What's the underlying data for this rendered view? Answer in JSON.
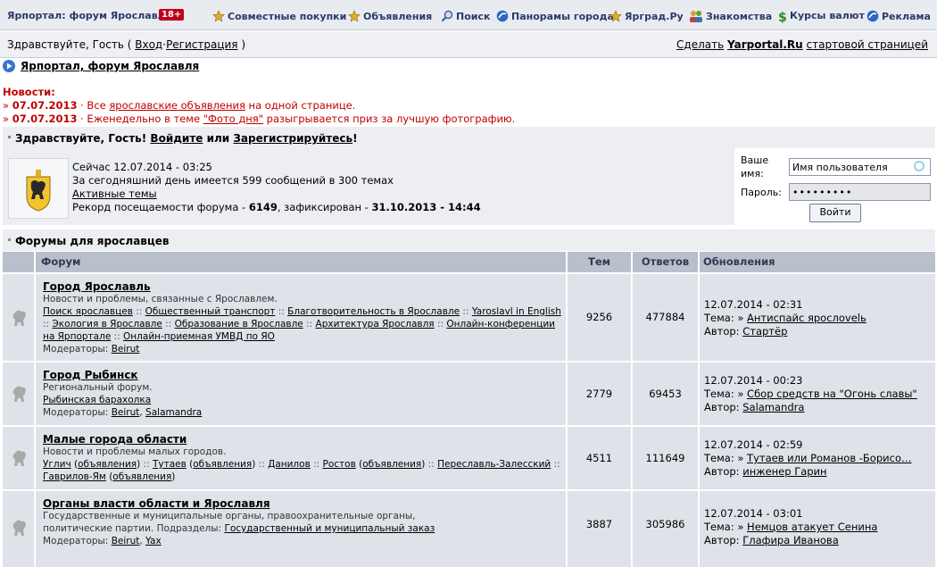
{
  "topbar": {
    "site_title": "Ярпортал: форум Ярославля",
    "age_badge": "18+",
    "nav": [
      {
        "label": "Совместные покупки",
        "icon": "star-icon"
      },
      {
        "label": "Объявления",
        "icon": "star-icon"
      },
      {
        "label": "Поиск",
        "icon": "search-icon"
      },
      {
        "label": "Панорамы города",
        "icon": "panorama-icon"
      },
      {
        "label": "Ярград.Ру",
        "icon": "star-icon"
      },
      {
        "label": "Знакомства",
        "icon": "people-icon"
      },
      {
        "label": "Курсы валют",
        "icon": "dollar-icon"
      },
      {
        "label": "Реклама",
        "icon": "panorama-icon"
      }
    ]
  },
  "greeting": {
    "prefix": "Здравствуйте, Гость (",
    "login": "Вход",
    "dot": "·",
    "register": "Регистрация",
    "suffix": ")",
    "make_start_pre": "Сделать",
    "make_start_bold": "Yarportal.Ru",
    "make_start_post": "стартовой страницей"
  },
  "breadcrumb": "Ярпортал, форум Ярославля",
  "news": {
    "title": "Новости:",
    "items": [
      {
        "date": "07.07.2013",
        "pre": " · Все ",
        "link": "ярославские объявления",
        "post": " на одной странице."
      },
      {
        "date": "07.07.2013",
        "pre": " · Еженедельно в теме ",
        "link": "\"Фото дня\"",
        "post": " разыгрывается приз за лучшую фотографию."
      }
    ]
  },
  "welcome": {
    "pre": "Здравствуйте, Гость! ",
    "login": "Войдите",
    "mid": " или ",
    "register": "Зарегистрируйтесь",
    "post": "!"
  },
  "stats": {
    "now": "Сейчас 12.07.2014 - 03:25",
    "today": "За сегодняшний день имеется 599 сообщений в 300 темах",
    "active": "Активные темы",
    "record_pre": "Рекорд посещаемости форума - ",
    "record_num": "6149",
    "record_mid": ", зафиксирован - ",
    "record_date": "31.10.2013 - 14:44"
  },
  "login": {
    "name_label_1": "Ваше",
    "name_label_2": "имя:",
    "name_value": "Имя пользователя",
    "pass_label": "Пароль:",
    "pass_value": "•••••••••",
    "button": "Войти"
  },
  "forums_header": "Форумы для ярославцев",
  "table": {
    "headers": {
      "forum": "Форум",
      "topics": "Тем",
      "replies": "Ответов",
      "updates": "Обновления"
    },
    "rows": [
      {
        "name": "Город Ярославль",
        "desc": "Новости и проблемы, связанные с Ярославлем.",
        "subs": [
          "Поиск ярославцев",
          "Общественный транспорт",
          "Благотворительность в Ярославле",
          "Yaroslavl in English",
          "Экология в Ярославле",
          "Образование в Ярославле",
          "Архитектура Ярославля",
          "Онлайн-конференции на Ярпортале",
          "Онлайн-приемная УМВД по ЯО"
        ],
        "moderators_label": "Модераторы: ",
        "moderators": [
          "Beirut"
        ],
        "topics": "9256",
        "replies": "477884",
        "upd_date": "12.07.2014 - 02:31",
        "upd_topic_label": "Тема:  » ",
        "upd_topic": "Антиспайс ярослоvelь",
        "upd_author_label": "Автор: ",
        "upd_author": "Стартёр"
      },
      {
        "name": "Город Рыбинск",
        "desc": "Региональный форум.",
        "subs": [
          "Рыбинская барахолка"
        ],
        "moderators_label": "Модераторы: ",
        "moderators": [
          "Beirut",
          "Salamandra"
        ],
        "topics": "2779",
        "replies": "69453",
        "upd_date": "12.07.2014 - 00:23",
        "upd_topic_label": "Тема:  » ",
        "upd_topic": "Сбор средств на \"Огонь славы\"",
        "upd_author_label": "Автор: ",
        "upd_author": "Salamandra"
      },
      {
        "name": "Малые города области",
        "desc": "Новости и проблемы малых городов.",
        "subs": [
          "Углич",
          "объявления",
          "Тутаев",
          "объявления",
          "Данилов",
          "Ростов",
          "объявления",
          "Переславль-Залесский",
          "Гаврилов-Ям",
          "объявления"
        ],
        "moderators_label": "",
        "moderators": [],
        "topics": "4511",
        "replies": "111649",
        "upd_date": "12.07.2014 - 02:59",
        "upd_topic_label": "Тема:  » ",
        "upd_topic": "Тутаев или Романов -Борисо…",
        "upd_author_label": "Автор: ",
        "upd_author": "инженер Гарин"
      },
      {
        "name": "Органы власти области и Ярославля",
        "desc": "Государственные и муниципальные органы, правоохранительные органы, политические партии. Подразделы: ",
        "subs": [
          "Государственный и муниципальный заказ"
        ],
        "moderators_label": "Модераторы: ",
        "moderators": [
          "Beirut",
          "Yax"
        ],
        "topics": "3887",
        "replies": "305986",
        "upd_date": "12.07.2014 - 03:01",
        "upd_topic_label": "Тема:  » ",
        "upd_topic": "Немцов атакует Сенина",
        "upd_author_label": "Автор: ",
        "upd_author": "Глафира Иванова"
      }
    ]
  }
}
